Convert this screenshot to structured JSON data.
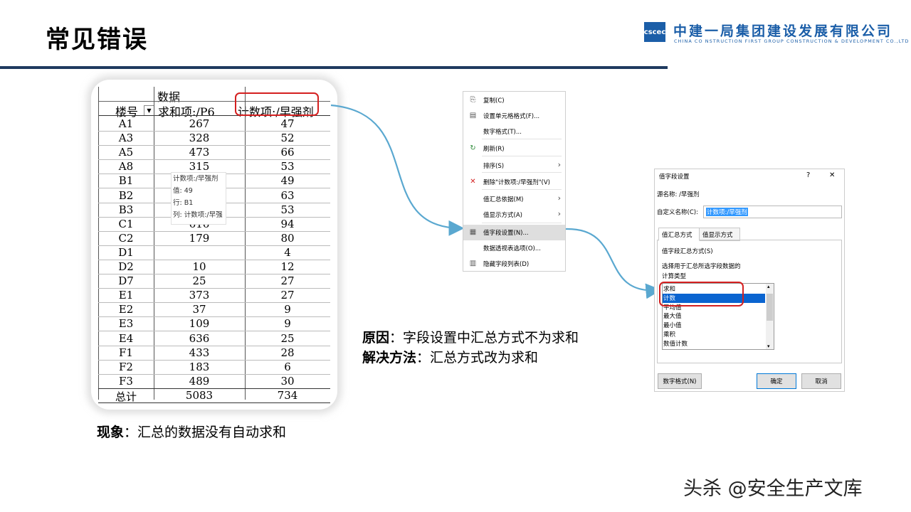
{
  "header": {
    "title": "常见错误",
    "logo_text": "cscec",
    "company_cn": "中建一局集团建设发展有限公司",
    "company_en": "CHINA CO NSTRUCTION FIRST GROUP CONSTRUCTION & DEVELOPMENT CO.,LTD"
  },
  "pivot": {
    "header_data": "数据",
    "col1": "楼号",
    "col2": "求和项:/P6",
    "col3": "计数项:/早强剂",
    "rows": [
      {
        "k": "A1",
        "sum": "267",
        "cnt": "47"
      },
      {
        "k": "A3",
        "sum": "328",
        "cnt": "52"
      },
      {
        "k": "A5",
        "sum": "473",
        "cnt": "66"
      },
      {
        "k": "A8",
        "sum": "315",
        "cnt": "53"
      },
      {
        "k": "B1",
        "sum": "",
        "cnt": "49"
      },
      {
        "k": "B2",
        "sum": "",
        "cnt": "63"
      },
      {
        "k": "B3",
        "sum": "",
        "cnt": "53"
      },
      {
        "k": "C1",
        "sum": "616",
        "cnt": "94"
      },
      {
        "k": "C2",
        "sum": "179",
        "cnt": "80"
      },
      {
        "k": "D1",
        "sum": "",
        "cnt": "4"
      },
      {
        "k": "D2",
        "sum": "10",
        "cnt": "12"
      },
      {
        "k": "D7",
        "sum": "25",
        "cnt": "27"
      },
      {
        "k": "E1",
        "sum": "373",
        "cnt": "27"
      },
      {
        "k": "E2",
        "sum": "37",
        "cnt": "9"
      },
      {
        "k": "E3",
        "sum": "109",
        "cnt": "9"
      },
      {
        "k": "E4",
        "sum": "636",
        "cnt": "25"
      },
      {
        "k": "F1",
        "sum": "433",
        "cnt": "28"
      },
      {
        "k": "F2",
        "sum": "183",
        "cnt": "6"
      },
      {
        "k": "F3",
        "sum": "489",
        "cnt": "30"
      },
      {
        "k": "总计",
        "sum": "5083",
        "cnt": "734"
      }
    ],
    "tooltip": [
      "计数项:/早强剂",
      "值: 49",
      "行: B1",
      "列: 计数项:/早强"
    ]
  },
  "context_menu": [
    {
      "label": "复制(C)",
      "icon": "copy-icon",
      "glyph": "⎘"
    },
    {
      "label": "设置单元格格式(F)...",
      "icon": "format-cells-icon",
      "glyph": "▤"
    },
    {
      "label": "数字格式(T)...",
      "icon": "",
      "glyph": ""
    },
    {
      "label": "刷新(R)",
      "icon": "refresh-icon",
      "glyph": "↻"
    },
    {
      "label": "排序(S)",
      "icon": "",
      "glyph": "",
      "sub": "›"
    },
    {
      "label": "删除\"计数项:/早强剂\"(V)",
      "icon": "delete-icon",
      "glyph": "✕"
    },
    {
      "label": "值汇总依据(M)",
      "icon": "",
      "glyph": "",
      "sub": "›"
    },
    {
      "label": "值显示方式(A)",
      "icon": "",
      "glyph": "",
      "sub": "›"
    },
    {
      "label": "值字段设置(N)...",
      "icon": "field-settings-icon",
      "glyph": "▦"
    },
    {
      "label": "数据透视表选项(O)...",
      "icon": "",
      "glyph": ""
    },
    {
      "label": "隐藏字段列表(D)",
      "icon": "field-list-icon",
      "glyph": "▥"
    }
  ],
  "dialog": {
    "title": "值字段设置",
    "help": "?",
    "close": "✕",
    "source_label": "源名称: /早强剂",
    "custom_label": "自定义名称(C):",
    "custom_value": "计数项:/早强剂",
    "tab1": "值汇总方式",
    "tab2": "值显示方式",
    "group_label": "值字段汇总方式(S)",
    "desc1": "选择用于汇总所选字段数据的",
    "desc2": "计算类型",
    "list": [
      "求和",
      "计数",
      "平均值",
      "最大值",
      "最小值",
      "乘积",
      "数值计数"
    ],
    "selected_index": 1,
    "btn_number_format": "数字格式(N)",
    "btn_ok": "确定",
    "btn_cancel": "取消"
  },
  "captions": {
    "cause_label": "原因",
    "cause_text": "：字段设置中汇总方式不为求和",
    "fix_label": "解决方法",
    "fix_text": "：汇总方式改为求和",
    "phen_label": "现象",
    "phen_text": "：汇总的数据没有自动求和"
  },
  "watermark": "头杀 @安全生产文库",
  "colors": {
    "accent": "#1b5ea8",
    "arrow": "#5aa8d0",
    "highlight_box": "#d42020",
    "selection": "#0a64d0"
  }
}
